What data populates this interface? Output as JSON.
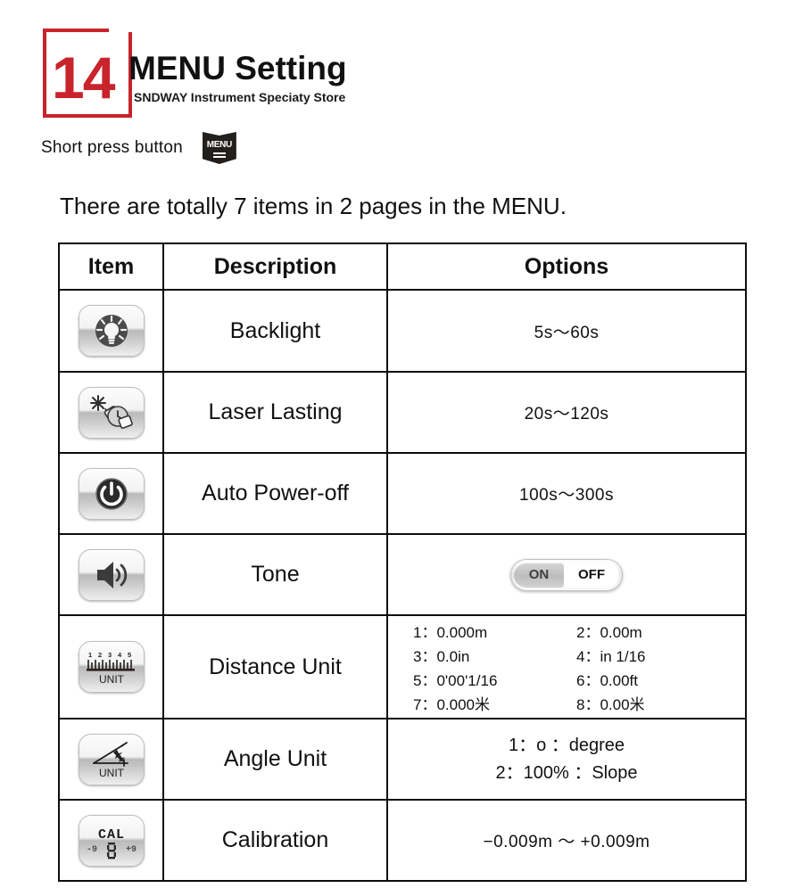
{
  "header": {
    "chapter_number": "14",
    "title": "MENU Setting",
    "subtitle": "SNDWAY Instrument Speciaty Store",
    "press_label": "Short press button",
    "menu_key_label": "MENU"
  },
  "intro": "There are totally 7 items in 2 pages in the MENU.",
  "table": {
    "headers": {
      "item": "Item",
      "description": "Description",
      "options": "Options"
    },
    "rows": [
      {
        "icon": "backlight-icon",
        "description": "Backlight",
        "options": "5s〜60s"
      },
      {
        "icon": "laser-icon",
        "description": "Laser Lasting",
        "options": "20s〜120s"
      },
      {
        "icon": "power-icon",
        "description": "Auto Power-off",
        "options": "100s〜300s"
      },
      {
        "icon": "speaker-icon",
        "description": "Tone",
        "options": ""
      },
      {
        "icon": "ruler-unit-icon",
        "description": "Distance Unit",
        "options": ""
      },
      {
        "icon": "angle-unit-icon",
        "description": "Angle Unit",
        "options": ""
      },
      {
        "icon": "calibration-icon",
        "description": "Calibration",
        "options": "−0.009m 〜 +0.009m"
      }
    ]
  },
  "tone_toggle": {
    "on_label": "ON",
    "off_label": "OFF"
  },
  "distance_units": [
    "1：0.000m",
    "2：0.00m",
    "3：0.0in",
    "4：in 1/16",
    "5：0'00'1/16",
    "6：0.00ft",
    "7：0.000米",
    "8：0.00米"
  ],
  "angle_units": [
    "1：o ：degree",
    "2：100%  ：Slope"
  ],
  "icon_labels": {
    "unit": "UNIT",
    "cal": "CAL",
    "cal_minus": "-9",
    "cal_plus": "+9",
    "ruler_ticks": "1 2 3 4 5"
  },
  "colors": {
    "accent_red": "#c9232b",
    "ink": "#111111",
    "key_dark": "#231f1c"
  }
}
